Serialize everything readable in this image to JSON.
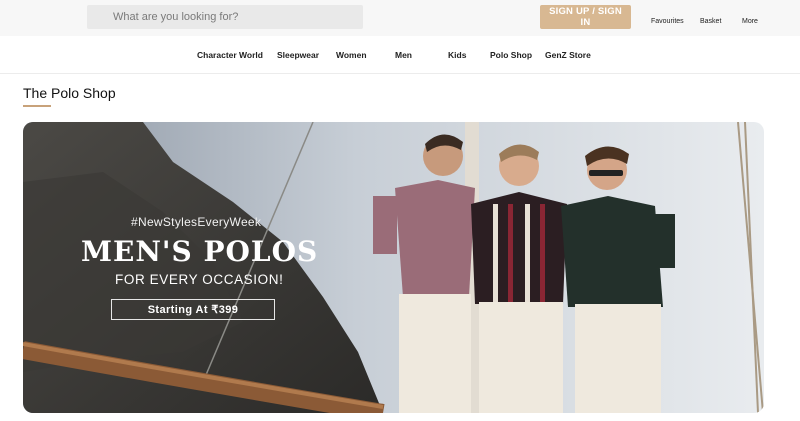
{
  "header": {
    "search_placeholder": "What are you looking for?",
    "signin_label": "SIGN UP / SIGN IN",
    "favourites_label": "Favourites",
    "basket_label": "Basket",
    "more_label": "More"
  },
  "nav": {
    "items": [
      "Character World",
      "Sleepwear",
      "Women",
      "Men",
      "Kids",
      "Polo Shop",
      "GenZ Store"
    ]
  },
  "section": {
    "title": "The Polo Shop"
  },
  "banner": {
    "hashtag": "#NewStylesEveryWeek",
    "headline": "MEN'S POLOS",
    "subline": "FOR EVERY OCCASION!",
    "price_text": "Starting At ₹399"
  },
  "colors": {
    "accent": "#d8b892",
    "underline": "#c8a27a"
  }
}
